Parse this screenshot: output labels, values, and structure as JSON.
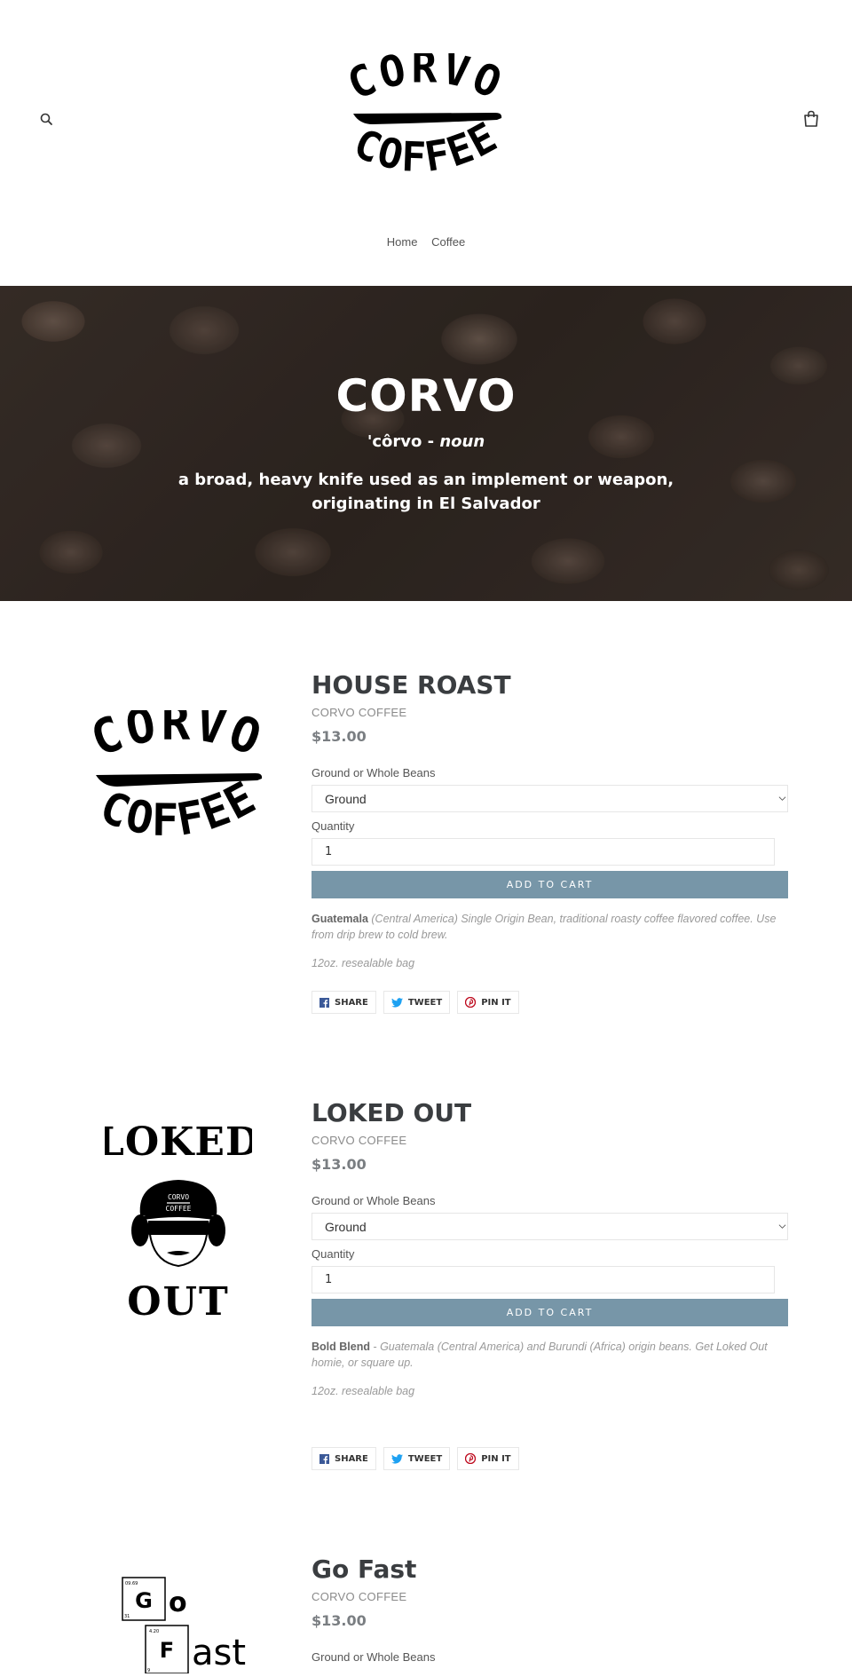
{
  "header": {
    "logo_alt": "Corvo Coffee",
    "logo_line1": "CORVO",
    "logo_line2": "COFFEE",
    "search_icon": "search-icon",
    "cart_icon": "shopping-bag-icon"
  },
  "nav": {
    "items": [
      {
        "label": "Home"
      },
      {
        "label": "Coffee"
      }
    ]
  },
  "hero": {
    "title": "CORVO",
    "pronunciation": "'côrvo - ",
    "part_of_speech": "noun",
    "definition": "a broad, heavy knife used as an implement or weapon, originating in El Salvador"
  },
  "products": [
    {
      "title": "HOUSE ROAST",
      "vendor": "CORVO COFFEE",
      "price": "$13.00",
      "variant_label": "Ground or Whole Beans",
      "variant_value": "Ground",
      "quantity_label": "Quantity",
      "quantity_value": "1",
      "add_to_cart": "ADD TO CART",
      "desc_bold": "Guatemala",
      "desc_italic": " (Central America) Single Origin Bean, traditional roasty coffee flavored coffee. Use from drip brew to cold brew.",
      "size_note": "12oz. resealable bag",
      "image_label": "CORVO COFFEE logo"
    },
    {
      "title": "LOKED OUT",
      "vendor": "CORVO COFFEE",
      "price": "$13.00",
      "variant_label": "Ground or Whole Beans",
      "variant_value": "Ground",
      "quantity_label": "Quantity",
      "quantity_value": "1",
      "add_to_cart": "ADD TO CART",
      "desc_bold": "Bold Blend",
      "desc_sep": " - ",
      "desc_italic": " Guatemala (Central America) and Burundi (Africa) origin beans. Get Loked Out homie, or square up.",
      "size_note": "12oz. resealable bag",
      "image_top": "LOKED",
      "image_bottom": "OUT",
      "image_cap_line1": "CORVO",
      "image_cap_line2": "COFFEE"
    },
    {
      "title": "Go Fast",
      "vendor": "CORVO COFFEE",
      "price": "$13.00",
      "variant_label": "Ground or Whole Beans",
      "image_g_num": "09.69",
      "image_g_letter": "G",
      "image_g_atomic": "31",
      "image_o": "o",
      "image_f_num": "4.20",
      "image_f_letter": "F",
      "image_f_atomic": "9",
      "image_ast": "ast"
    }
  ],
  "share": {
    "share_label": "SHARE",
    "tweet_label": "TWEET",
    "pin_label": "PIN IT"
  },
  "colors": {
    "accent_button": "#7796a8",
    "facebook": "#3b5998",
    "twitter": "#1da1f2",
    "pinterest": "#bd081c"
  }
}
